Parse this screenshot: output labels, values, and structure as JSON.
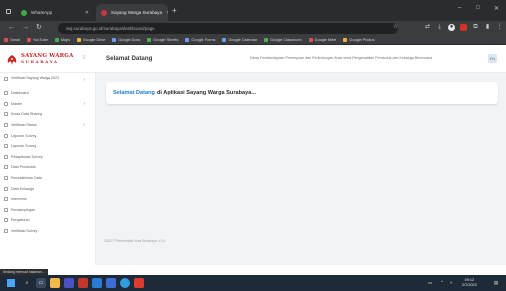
{
  "browser": {
    "tabs": [
      {
        "title": "WhatsApp",
        "active": false
      },
      {
        "title": "Sayang Warga Surabaya",
        "active": true
      }
    ],
    "new_tab_symbol": "+",
    "address": "swj.surabaya.go.id/surabaya/dashboard/page",
    "window_controls": {
      "minimize": "–",
      "maximize": "□",
      "close": "✕"
    },
    "nav": {
      "back": "←",
      "forward": "→",
      "reload": "↻"
    }
  },
  "bookmarks": [
    {
      "label": "Gmail",
      "color": "r"
    },
    {
      "label": "YouTube",
      "color": "r"
    },
    {
      "label": "Maps",
      "color": "g"
    },
    {
      "label": "Google Drive",
      "color": "y"
    },
    {
      "label": "Google Docs",
      "color": "b"
    },
    {
      "label": "Google Sheets",
      "color": "g"
    },
    {
      "label": "Google Forms",
      "color": "b"
    },
    {
      "label": "Google Calendar",
      "color": "b"
    },
    {
      "label": "Google Classroom",
      "color": "g"
    },
    {
      "label": "Google Meet",
      "color": "r"
    },
    {
      "label": "Google Photos",
      "color": "y"
    }
  ],
  "header": {
    "logo_line1": "SAYANG WARGA",
    "logo_line2": "SURABAYA",
    "menu_icon": "≡",
    "title": "Selamat Datang",
    "subtitle": "Dinas Pemberdayaan Perempuan dan Perlindungan Anak serta Pengendalian Penduduk dan Keluarga Berencana",
    "badge": "EN"
  },
  "sidebar": {
    "items": [
      {
        "label": "Verifikasi Sayang Warga 2023",
        "chevron": "›",
        "tall": true
      },
      {
        "label": "Dashboard",
        "chevron": ""
      },
      {
        "label": "Master",
        "chevron": "›"
      },
      {
        "label": "Kuota Data Sharing",
        "chevron": ""
      },
      {
        "label": "Verifikasi Status",
        "chevron": "›"
      },
      {
        "label": "Laporan Survey",
        "chevron": ""
      },
      {
        "label": "Laporan Survey",
        "chevron": ""
      },
      {
        "label": "Rekapitulasi Survey",
        "chevron": ""
      },
      {
        "label": "Data Penduduk",
        "chevron": ""
      },
      {
        "label": "Pemutakhiran Data",
        "chevron": ""
      },
      {
        "label": "Data Keluarga",
        "chevron": ""
      },
      {
        "label": "Intervensi",
        "chevron": ""
      },
      {
        "label": "Pendampingan",
        "chevron": ""
      },
      {
        "label": "Pengaturan",
        "chevron": ""
      },
      {
        "label": "Verifikasi Survey",
        "chevron": ""
      }
    ]
  },
  "main": {
    "welcome_highlight": "Selamat Datang",
    "welcome_rest": "di Aplikasi Sayang Warga Surabaya...",
    "footer": "2023 © Pemerintah Kota Surabaya. v1.0"
  },
  "statusbar": {
    "text": "Sedang memuat halaman..."
  },
  "taskbar": {
    "time": "09:12",
    "date": "2/7/2023"
  },
  "colors": {
    "brand_red": "#c7252a",
    "accent_blue": "#1f7ed8",
    "browser_dark": "#3b3c3f"
  }
}
